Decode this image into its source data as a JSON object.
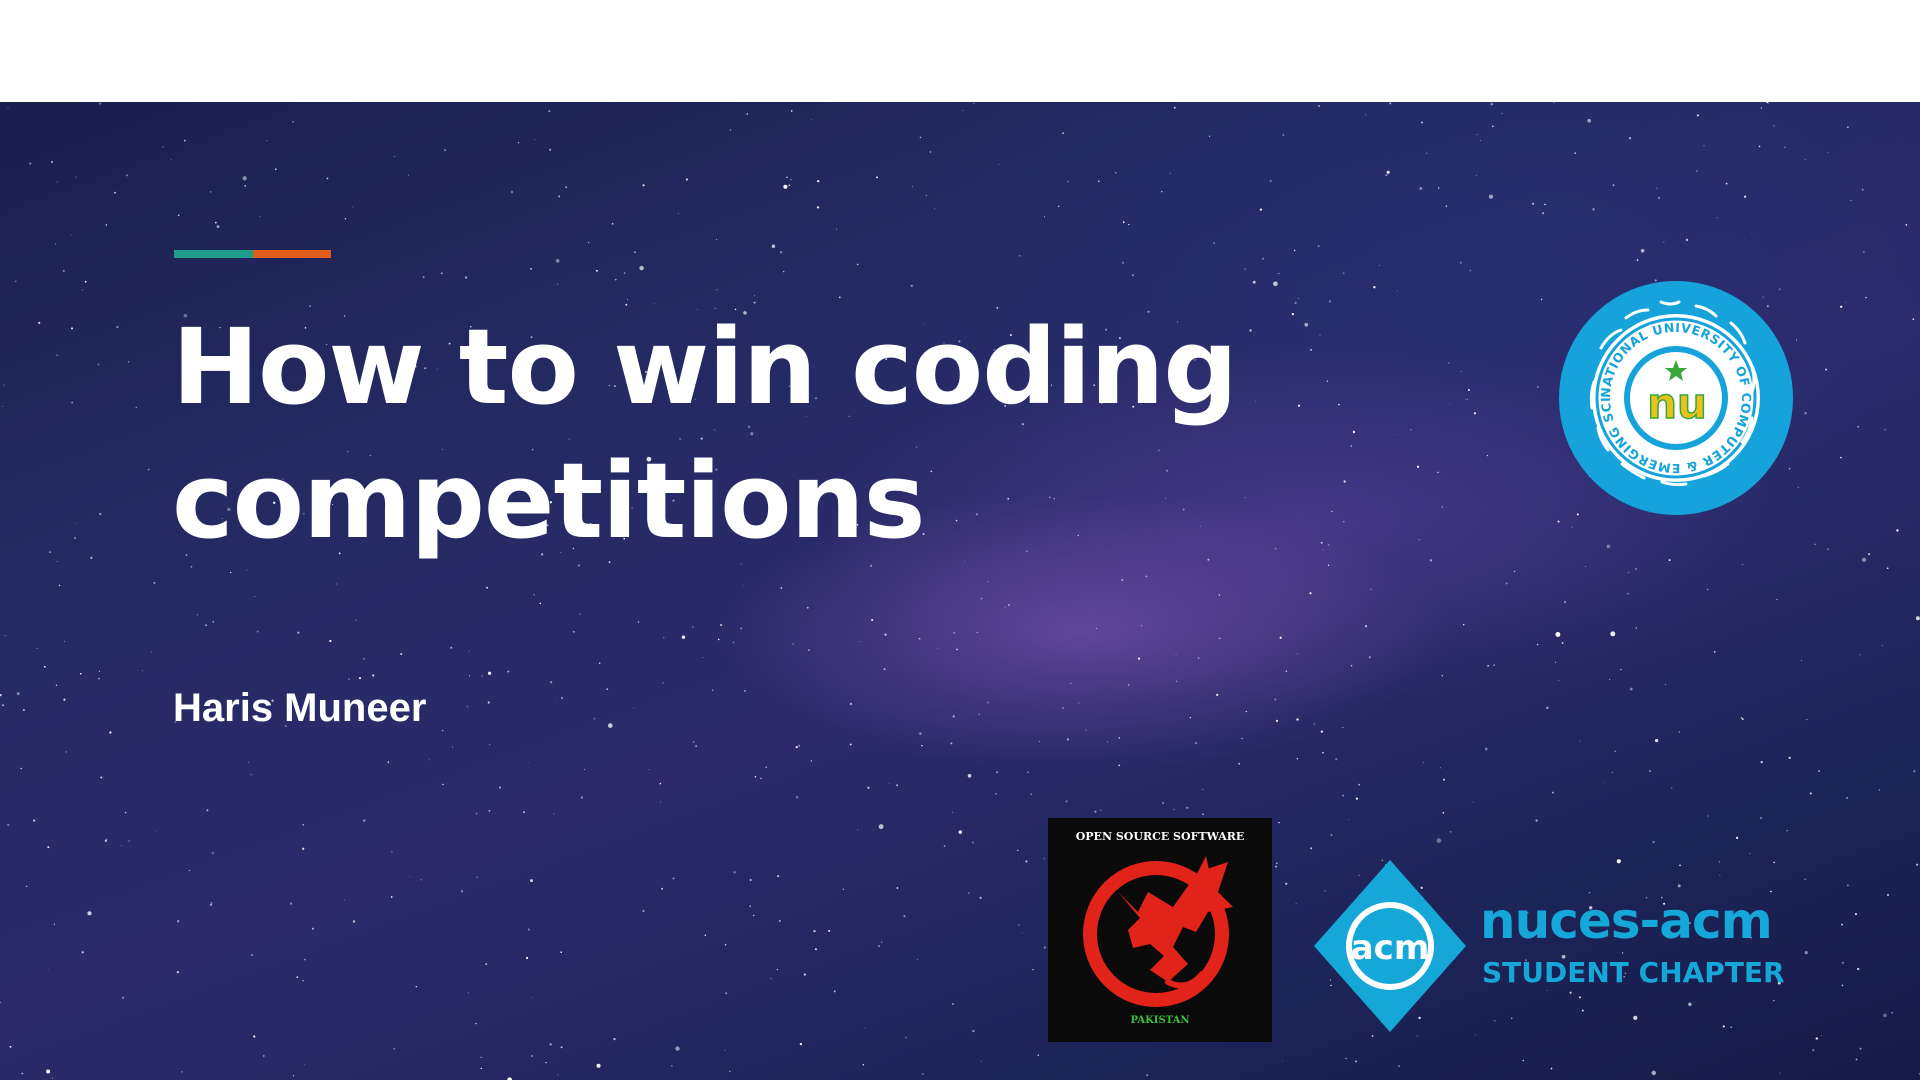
{
  "slide": {
    "title": "How to win coding competitions",
    "author": "Haris Muneer",
    "accent_colors": [
      "#1f9e8e",
      "#e05d1c"
    ]
  },
  "logos": {
    "fast_nu": {
      "icon": "university-seal-icon",
      "ring_text": "NATIONAL UNIVERSITY OF COMPUTER & EMERGING SCIENCES",
      "center_text": "nu",
      "color": "#16a3dc"
    },
    "oss": {
      "icon": "red-dragon-icon",
      "top_text": "OPEN SOURCE SOFTWARE",
      "bottom_text": "PAKISTAN",
      "color": "#e2231a"
    },
    "acm": {
      "icon": "acm-diamond-icon",
      "badge_text": "acm",
      "name": "nuces-acm",
      "subtitle": "STUDENT CHAPTER",
      "color": "#14a7d8"
    }
  }
}
